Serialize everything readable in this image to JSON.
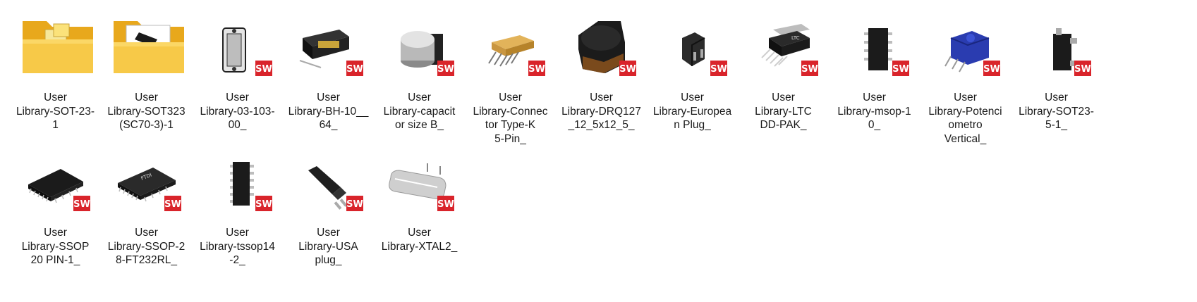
{
  "files": [
    {
      "name": "User\nLibrary-SOT-23-\n1",
      "icon": "folder-icon",
      "badge": ""
    },
    {
      "name": "User\nLibrary-SOT323\n(SC70-3)-1",
      "icon": "folder-icon",
      "badge": ""
    },
    {
      "name": "User\nLibrary-03-103-\n00_",
      "icon": "part-box-icon",
      "badge": "SW"
    },
    {
      "name": "User\nLibrary-BH-10__\n64_",
      "icon": "part-header-icon",
      "badge": "SW"
    },
    {
      "name": "User\nLibrary-capacit\nor size B_",
      "icon": "part-capacitor-icon",
      "badge": "SW"
    },
    {
      "name": "User\nLibrary-Connec\ntor Type-K\n5-Pin_",
      "icon": "part-connector-icon",
      "badge": "SW"
    },
    {
      "name": "User\nLibrary-DRQ127\n_12_5x12_5_",
      "icon": "part-inductor-icon",
      "badge": "SW"
    },
    {
      "name": "User\nLibrary-Europea\nn Plug_",
      "icon": "part-eu-plug-icon",
      "badge": "SW"
    },
    {
      "name": "User\nLibrary-LTC\nDD-PAK_",
      "icon": "part-ddpak-icon",
      "badge": "SW"
    },
    {
      "name": "User\nLibrary-msop-1\n0_",
      "icon": "part-msop-icon",
      "badge": "SW"
    },
    {
      "name": "User\nLibrary-Potenci\nometro\nVertical_",
      "icon": "part-potentiometer-icon",
      "badge": "SW"
    },
    {
      "name": "User\nLibrary-SOT23-\n5-1_",
      "icon": "part-sot23-icon",
      "badge": "SW"
    },
    {
      "name": "User\nLibrary-SSOP\n20 PIN-1_",
      "icon": "part-ssop20-icon",
      "badge": "SW"
    },
    {
      "name": "User\nLibrary-SSOP-2\n8-FT232RL_",
      "icon": "part-ssop28-icon",
      "badge": "SW"
    },
    {
      "name": "User\nLibrary-tssop14\n-2_",
      "icon": "part-tssop-icon",
      "badge": "SW"
    },
    {
      "name": "User\nLibrary-USA\nplug_",
      "icon": "part-usa-plug-icon",
      "badge": "SW"
    },
    {
      "name": "User\nLibrary-XTAL2_",
      "icon": "part-crystal-icon",
      "badge": "SW"
    }
  ],
  "colors": {
    "folder": "#f7c948",
    "folder_dark": "#e8a81c",
    "badge_red": "#d9242b",
    "text": "#1a1a1a"
  }
}
